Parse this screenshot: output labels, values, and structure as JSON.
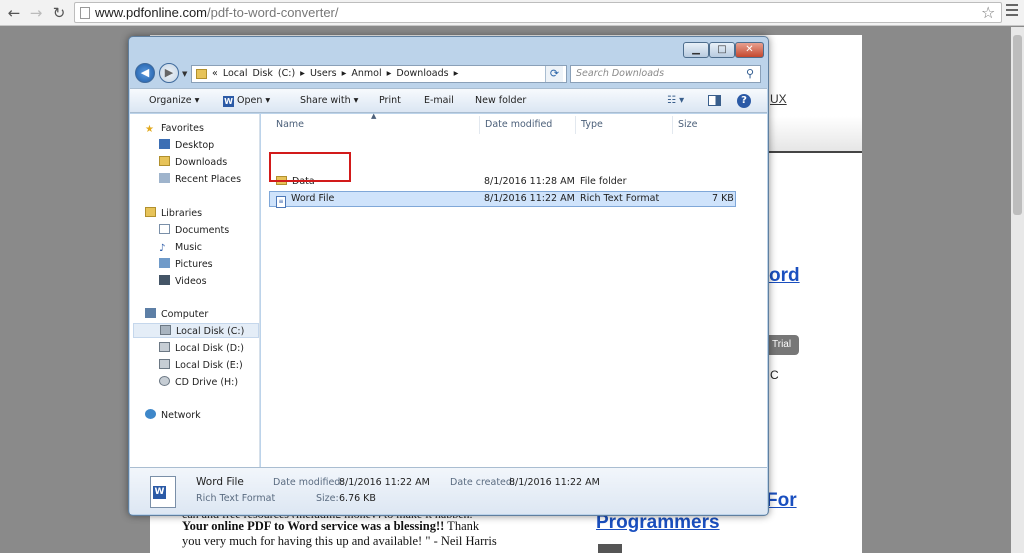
{
  "browser": {
    "url_host": "www.pdfonline.com",
    "url_path": "/pdf-to-word-converter/"
  },
  "background_page": {
    "link_fragment_1": "UX",
    "heading_fragment_1": "ord",
    "button_fragment": "Trial",
    "text_fragment": "C",
    "heading_fragment_2": "For",
    "heading_fragment_3": "Programmers",
    "testimonial_cut": "can and free resources (including money) to make it happen.",
    "testimonial_bold": "Your online PDF to Word service was a blessing!!",
    "testimonial_rest_1": " Thank",
    "testimonial_rest_2": "you very much for having this up and available! \" - Neil Harris"
  },
  "dialog": {
    "address": {
      "crumbs": "« Local Disk (C:) ▸ Users ▸ Anmol ▸ Downloads ▸"
    },
    "search_placeholder": "Search Downloads",
    "toolbar": {
      "organize": "Organize ▾",
      "open": "Open ▾",
      "share_with": "Share with ▾",
      "print": "Print",
      "email": "E-mail",
      "new_folder": "New folder"
    },
    "nav": {
      "favorites": "Favorites",
      "desktop": "Desktop",
      "downloads": "Downloads",
      "recent_places": "Recent Places",
      "libraries": "Libraries",
      "documents": "Documents",
      "music": "Music",
      "pictures": "Pictures",
      "videos": "Videos",
      "computer": "Computer",
      "local_c": "Local Disk (C:)",
      "local_d": "Local Disk (D:)",
      "local_e": "Local Disk (E:)",
      "cd_drive": "CD Drive (H:)",
      "network": "Network"
    },
    "columns": {
      "name": "Name",
      "date_modified": "Date modified",
      "type": "Type",
      "size": "Size"
    },
    "files": [
      {
        "name": "Data",
        "date": "8/1/2016 11:28 AM",
        "type": "File folder",
        "size": ""
      },
      {
        "name": "Word File",
        "date": "8/1/2016 11:22 AM",
        "type": "Rich Text Format",
        "size": "7 KB"
      }
    ],
    "details": {
      "name": "Word File",
      "type": "Rich Text Format",
      "date_modified_label": "Date modified:",
      "date_modified": "8/1/2016 11:22 AM",
      "date_created_label": "Date created:",
      "date_created": "8/1/2016 11:22 AM",
      "size_label": "Size:",
      "size": "6.76 KB"
    }
  }
}
